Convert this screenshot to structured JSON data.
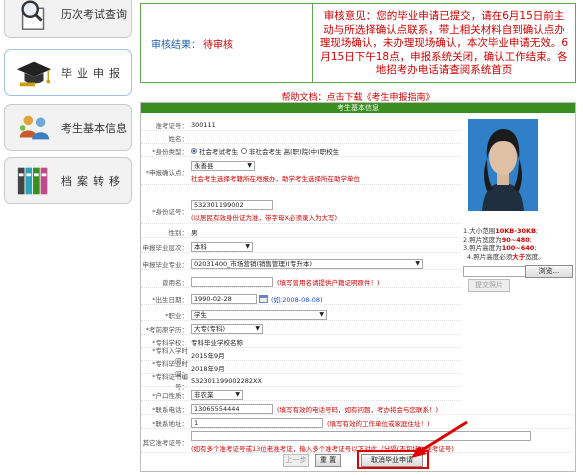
{
  "nav": {
    "items": [
      {
        "label": "历次考试查询"
      },
      {
        "label": "毕业申报"
      },
      {
        "label": "考生基本信息"
      },
      {
        "label": "档案转移"
      }
    ]
  },
  "review": {
    "result_label": "审核结果：",
    "result_status": "待审核",
    "opinion": "审核意见：您的毕业申请已提交，请在6月15日前主动与所选择确认点联系，带上相关材料自到确认点办理现场确认，未办理现场确认，本次毕业申请无效。6月15日下午18点，申报系统关闭，确认工作结束。各地招考办电话请查阅系统首页"
  },
  "help": "帮助文档：点击下载《考生申报指南》",
  "form": {
    "section_title": "考生基本信息",
    "fields": {
      "exam_no": {
        "label": "准考证号：",
        "value": "300111"
      },
      "name": {
        "label": "姓名："
      },
      "identity": {
        "label": "*身份类型：",
        "opt1": "社会考试考生",
        "opt2": "非社会考生 高(职)院(中)职校生"
      },
      "confirm_point": {
        "label": "*申报确认点：",
        "value": "永善县",
        "note": "社会考生选择考籍所在地报办，助学考生选择所在助学单位"
      },
      "id_no": {
        "label": "*身份证号：",
        "value": "532301199002",
        "note": "(以居民有效身份证为准，带字母X必须录入为大写)"
      },
      "gender": {
        "label": "性别：",
        "value": "男"
      },
      "level": {
        "label": "申报毕业层次：",
        "value": "本科"
      },
      "major": {
        "label": "申报毕业专业：",
        "value": "02031400_市场营销(销售管理)(专升本)"
      },
      "former_name": {
        "label": "曾用名：",
        "note": "(填写曾用名请提供户籍证明原件！)"
      },
      "birth": {
        "label": "*出生日期：",
        "value": "1990-02-28",
        "note": "(如:2008-08-08)"
      },
      "occupation": {
        "label": "*职业：",
        "value": "学生"
      },
      "prev_edu": {
        "label": "*考前原学历：",
        "value": "大专(专科)"
      },
      "school": {
        "label": "*专科学校：",
        "value": "专科毕业学校名称"
      },
      "enroll": {
        "label": "*专科入学时间：",
        "value": "2015年9月"
      },
      "graduate": {
        "label": "*专科毕业时间：",
        "value": "2018年9月"
      },
      "cert_no": {
        "label": "*专科证书编号：",
        "value": "53230119900228​2XX"
      },
      "hukou": {
        "label": "*户口性质：",
        "value": "非农業"
      },
      "phone": {
        "label": "*联系电话：",
        "value": "13065554444",
        "note": "(填写有效的电话号码，如有问题，考办将会与您联系！)"
      },
      "address": {
        "label": "*联系地址：",
        "value": "1",
        "note": "(填写有效的工作单位或家庭住址！)"
      },
      "other_no": {
        "label": "其它准考证号：",
        "note": "(如有多个准考证号或13位老准考证，输入多个准考证号以下对此（分隔(不包括主准考证号)"
      }
    }
  },
  "photo_tips": {
    "line1": "1.大小范围",
    "line1b": "10KB-30KB",
    "line2": "2.照片宽度为",
    "line2b": "90~480",
    "line3": "3.照片高度为",
    "line3b": "100~640",
    "line4": "4.照片高度必须",
    "line4b": "大于",
    "line4c": "宽度。"
  },
  "buttons": {
    "browse": "浏览...",
    "upload": "提交照片",
    "prev": "上一步",
    "reset": "重 置",
    "cancel": "取消毕业申请"
  },
  "colors": {
    "accent_green": "#3a8d1f",
    "alert_red": "#d00000",
    "link_blue": "#1a5ea8"
  }
}
